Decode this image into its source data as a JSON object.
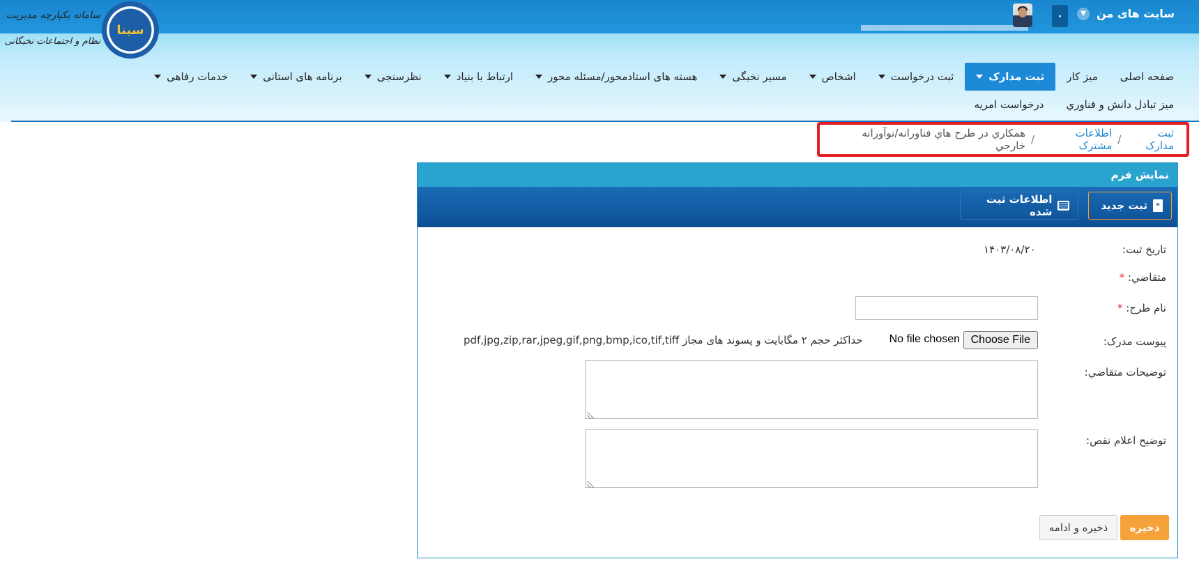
{
  "topbar": {
    "my_sites": "سایت های من",
    "notif_count": "۰"
  },
  "logo": {
    "line1": "سامانه یکپارچه مدیریت",
    "line2": "نظام و اجتماعات نخبگانی",
    "seal_text": "سینا"
  },
  "nav": {
    "items": [
      {
        "label": "صفحه اصلی",
        "dropdown": false,
        "active": false
      },
      {
        "label": "میز کار",
        "dropdown": false,
        "active": false
      },
      {
        "label": "ثبت مدارک",
        "dropdown": true,
        "active": true
      },
      {
        "label": "ثبت درخواست",
        "dropdown": true,
        "active": false
      },
      {
        "label": "اشخاص",
        "dropdown": true,
        "active": false
      },
      {
        "label": "مسیر نخبگی",
        "dropdown": true,
        "active": false
      },
      {
        "label": "هسته های استادمحور/مسئله محور",
        "dropdown": true,
        "active": false
      },
      {
        "label": "ارتباط با بنیاد",
        "dropdown": true,
        "active": false
      },
      {
        "label": "نظرسنجی",
        "dropdown": true,
        "active": false
      },
      {
        "label": "برنامه های استانی",
        "dropdown": true,
        "active": false
      },
      {
        "label": "خدمات رفاهی",
        "dropdown": true,
        "active": false
      }
    ],
    "row2": [
      {
        "label": "میز تبادل دانش و فناوري"
      },
      {
        "label": "درخواست امریه"
      }
    ]
  },
  "breadcrumb": {
    "item1": "ثبت مدارک",
    "item2": "اطلاعات مشترک",
    "current": "همکاري در طرح هاي فناورانه/نوآورانه خارجي",
    "sep": "/"
  },
  "panel": {
    "title": "نمایش فرم",
    "new_button": "ثبت جدید",
    "registered_button": "اطلاعات ثبت شده"
  },
  "form": {
    "reg_date_label": "تاریخ ثبت:",
    "reg_date_value": "۱۴۰۳/۰۸/۲۰",
    "applicant_label": "متقاضي:",
    "plan_name_label": "نام طرح:",
    "plan_name_value": "",
    "attachment_label": "پیوست مدرک:",
    "choose_file": "Choose File",
    "no_file": "No file chosen",
    "file_hint": "حداکثر حجم ۲ مگابایت و پسوند های مجاز pdf,jpg,zip,rar,jpeg,gif,png,bmp,ico,tif,tiff",
    "applicant_desc_label": "توضیحات متقاضي:",
    "defect_desc_label": "توضیح اعلام نقص:",
    "required_mark": "*"
  },
  "actions": {
    "save": "ذخیره",
    "save_continue": "ذخیره و ادامه"
  }
}
